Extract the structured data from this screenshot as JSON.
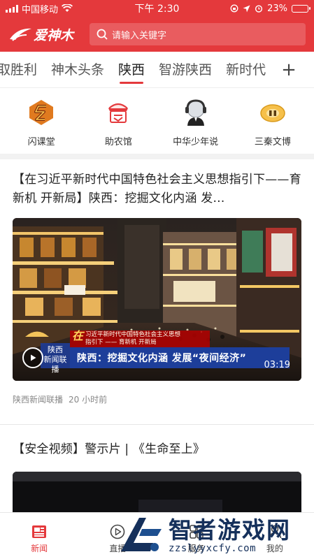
{
  "status_bar": {
    "carrier": "中国移动",
    "time": "下午 2:30",
    "battery": "23%",
    "battery_fraction": 0.23
  },
  "header": {
    "logo_text": "爱神木",
    "search_placeholder": "请输入关键字"
  },
  "tabs": {
    "items": [
      "取胜利",
      "神木头条",
      "陕西",
      "智游陕西",
      "新时代"
    ],
    "active_index": 2,
    "add_symbol": "+"
  },
  "quick_entries": [
    {
      "label": "闪课堂",
      "icon": "flash-class-icon"
    },
    {
      "label": "助农馆",
      "icon": "farm-store-icon"
    },
    {
      "label": "中华少年说",
      "icon": "youth-speaker-icon"
    },
    {
      "label": "三秦文博",
      "icon": "museum-icon"
    }
  ],
  "articles": [
    {
      "title": "【在习近平新时代中国特色社会主义思想指引下——育新机 开新局】陕西：挖掘文化内涵 发…",
      "video": {
        "duration": "03:19",
        "banner_main": "陕西：挖掘文化内涵 发展“夜间经济”",
        "banner_sub_line1": "习近平新时代中国特色社会主义思想",
        "banner_sub_line2": "指引下 —— 育新机 开新局",
        "banner_zai": "在",
        "station_line1": "陕西",
        "station_line2": "新闻联播"
      },
      "source": "陕西新闻联播",
      "time_ago": "20 小时前"
    },
    {
      "title": "【安全视频】警示片 | 《生命至上》"
    }
  ],
  "bottom_nav": [
    {
      "label": "新闻",
      "icon": "news-icon",
      "active": true
    },
    {
      "label": "直播",
      "icon": "live-icon",
      "active": false
    },
    {
      "label": "服务",
      "icon": "service-icon",
      "active": false
    },
    {
      "label": "我的",
      "icon": "profile-icon",
      "active": false
    }
  ],
  "watermark": {
    "title": "智者游戏网",
    "url": "zzslyyxcfy.com"
  },
  "colors": {
    "brand_red": "#e4393c",
    "watermark_navy": "#15305b"
  }
}
